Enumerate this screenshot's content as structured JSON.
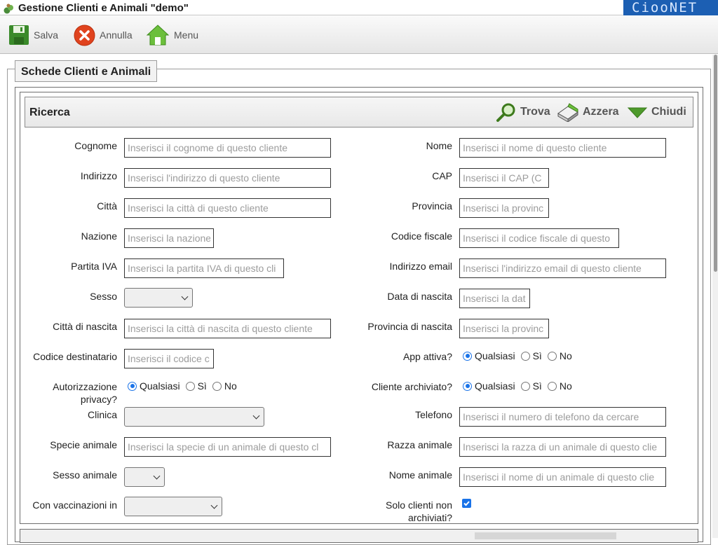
{
  "window": {
    "title": "Gestione Clienti e Animali \"demo\"",
    "brand": "CiooNET"
  },
  "toolbar": {
    "save": "Salva",
    "cancel": "Annulla",
    "menu": "Menu"
  },
  "section": {
    "legend": "Schede Clienti e Animali"
  },
  "search": {
    "title": "Ricerca",
    "find": "Trova",
    "reset": "Azzera",
    "close": "Chiudi"
  },
  "form": {
    "cognome": {
      "label": "Cognome",
      "placeholder": "Inserisci il cognome di questo cliente"
    },
    "nome": {
      "label": "Nome",
      "placeholder": "Inserisci il nome di questo cliente"
    },
    "indirizzo": {
      "label": "Indirizzo",
      "placeholder": "Inserisci l'indirizzo di questo cliente"
    },
    "cap": {
      "label": "CAP",
      "placeholder": "Inserisci il CAP (C"
    },
    "citta": {
      "label": "Città",
      "placeholder": "Inserisci la città di questo cliente"
    },
    "provincia": {
      "label": "Provincia",
      "placeholder": "Inserisci la provinc"
    },
    "nazione": {
      "label": "Nazione",
      "placeholder": "Inserisci la nazione"
    },
    "codice_fiscale": {
      "label": "Codice fiscale",
      "placeholder": "Inserisci il codice fiscale di questo"
    },
    "partita_iva": {
      "label": "Partita IVA",
      "placeholder": "Inserisci la partita IVA di questo cli"
    },
    "email": {
      "label": "Indirizzo email",
      "placeholder": "Inserisci l'indirizzo email di questo cliente"
    },
    "sesso": {
      "label": "Sesso",
      "value": ""
    },
    "data_nascita": {
      "label": "Data di nascita",
      "placeholder": "Inserisci la dat"
    },
    "citta_nascita": {
      "label": "Città di nascita",
      "placeholder": "Inserisci la città di nascita di questo cliente"
    },
    "provincia_nascita": {
      "label": "Provincia di nascita",
      "placeholder": "Inserisci la provinc"
    },
    "codice_destinatario": {
      "label": "Codice destinatario",
      "placeholder": "Inserisci il codice c"
    },
    "app_attiva": {
      "label": "App attiva?",
      "options": [
        "Qualsiasi",
        "Sì",
        "No"
      ],
      "selected": "Qualsiasi"
    },
    "privacy": {
      "label_line1": "Autorizzazione",
      "label_line2": "privacy?",
      "options": [
        "Qualsiasi",
        "Sì",
        "No"
      ],
      "selected": "Qualsiasi"
    },
    "archiviato": {
      "label": "Cliente archiviato?",
      "options": [
        "Qualsiasi",
        "Sì",
        "No"
      ],
      "selected": "Qualsiasi"
    },
    "clinica": {
      "label": "Clinica",
      "value": ""
    },
    "telefono": {
      "label": "Telefono",
      "placeholder": "Inserisci il numero di telefono da cercare"
    },
    "specie": {
      "label": "Specie animale",
      "placeholder": "Inserisci la specie di un animale di questo cl"
    },
    "razza": {
      "label": "Razza animale",
      "placeholder": "Inserisci la razza di un animale di questo clie"
    },
    "sesso_animale": {
      "label": "Sesso animale",
      "value": ""
    },
    "nome_animale": {
      "label": "Nome animale",
      "placeholder": "Inserisci il nome di un animale di questo clie"
    },
    "vaccinazioni": {
      "label": "Con vaccinazioni in",
      "value": ""
    },
    "solo_non_archiviati": {
      "label_line1": "Solo clienti non",
      "label_line2": "archiviati?",
      "checked": true
    }
  },
  "colors": {
    "brand_bg": "#1c5fb3",
    "accent": "#1a73e8"
  }
}
